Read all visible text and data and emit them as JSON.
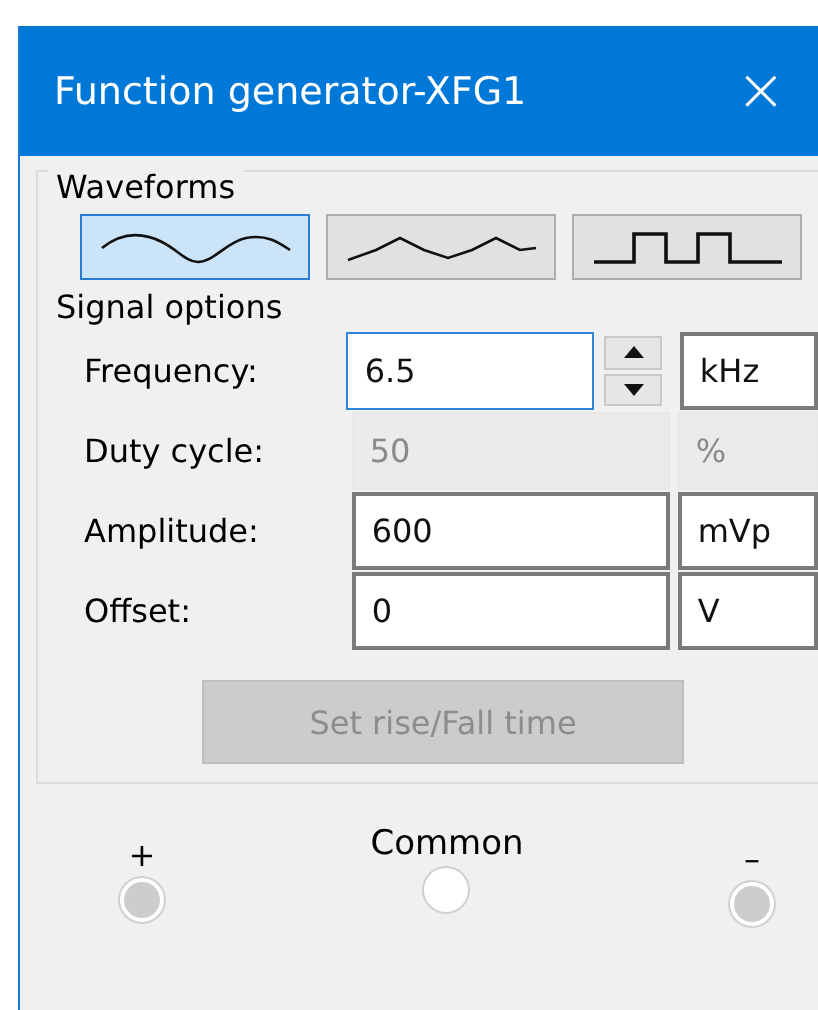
{
  "window": {
    "title": "Function generator-XFG1",
    "close": "×"
  },
  "waveforms": {
    "label": "Waveforms",
    "items": [
      {
        "kind": "sine",
        "selected": true
      },
      {
        "kind": "triangle",
        "selected": false
      },
      {
        "kind": "square",
        "selected": false
      }
    ]
  },
  "signal_options": {
    "label": "Signal options",
    "rows": [
      {
        "label": "Frequency:",
        "value": "6.5",
        "unit": "kHz",
        "focused": true,
        "disabled": false,
        "spinner": true
      },
      {
        "label": "Duty cycle:",
        "value": "50",
        "unit": "%",
        "focused": false,
        "disabled": true,
        "spinner": false
      },
      {
        "label": "Amplitude:",
        "value": "600",
        "unit": "mVp",
        "focused": false,
        "disabled": false,
        "spinner": false
      },
      {
        "label": "Offset:",
        "value": "0",
        "unit": "V",
        "focused": false,
        "disabled": false,
        "spinner": false
      }
    ],
    "button": {
      "label": "Set rise/Fall time",
      "disabled": true
    }
  },
  "terminals": [
    {
      "label": "+",
      "connected": true
    },
    {
      "label": "Common",
      "connected": false
    },
    {
      "label": "–",
      "connected": true
    }
  ]
}
